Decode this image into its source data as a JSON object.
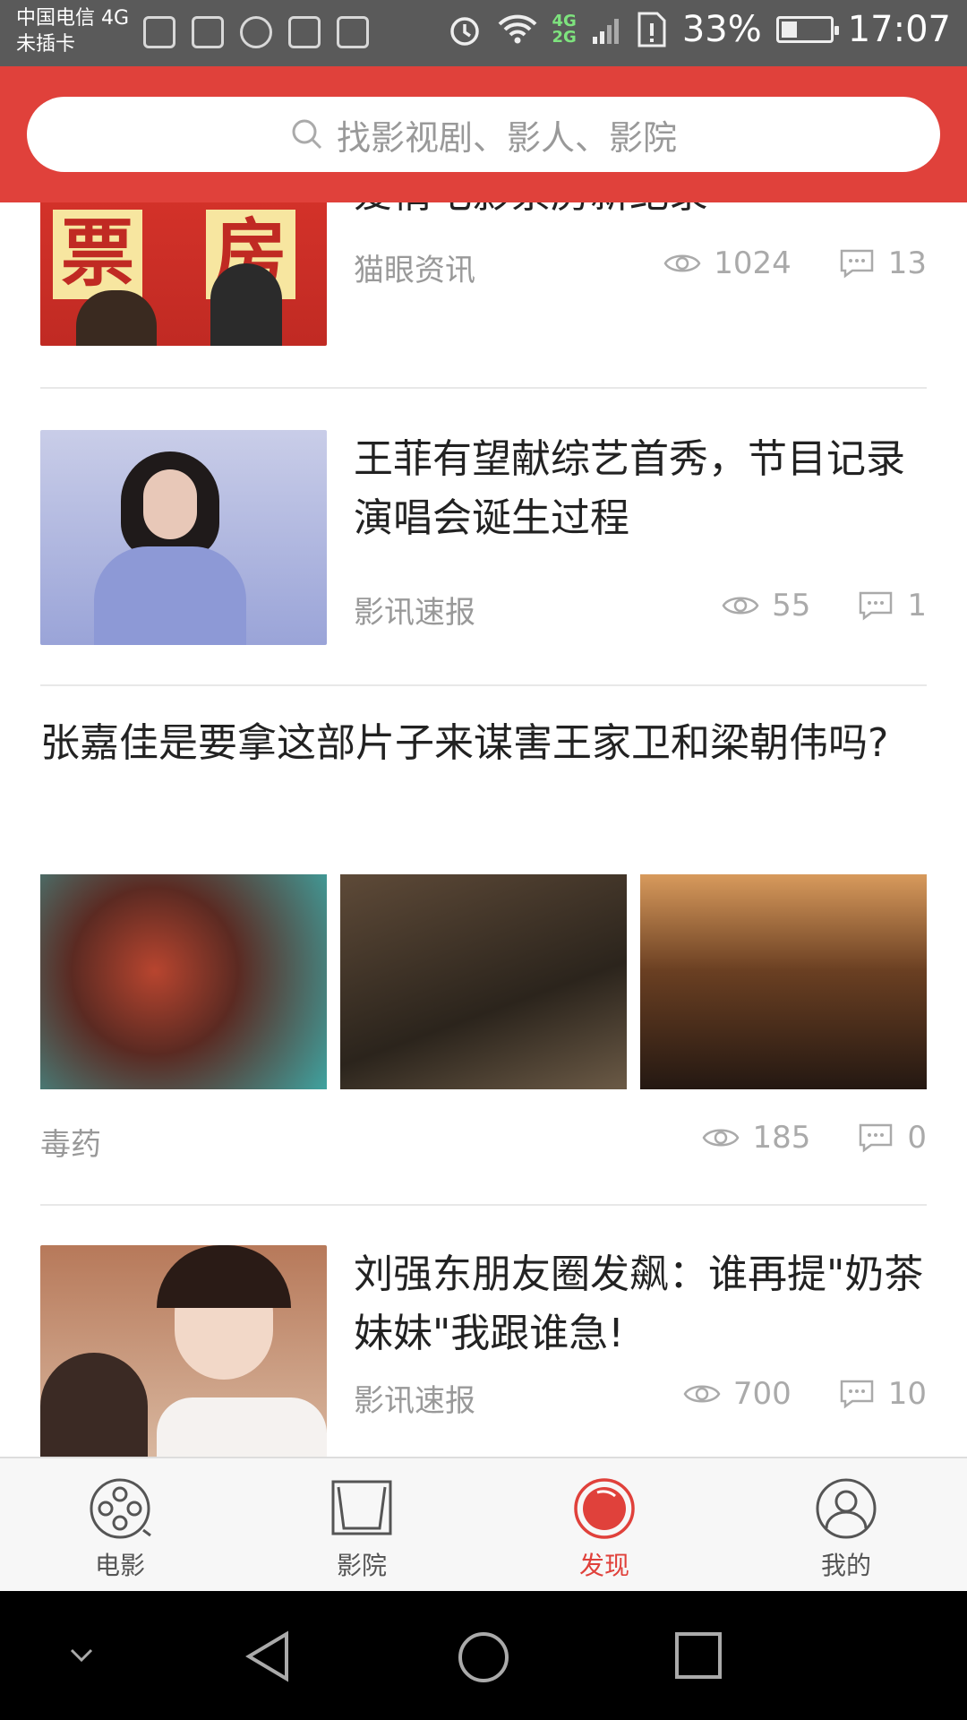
{
  "status_bar": {
    "carrier_line1": "中国电信 4G",
    "carrier_line2": "未插卡",
    "net_4g": "4G",
    "net_2g": "2G",
    "battery": "33%",
    "battery_level": 0.33,
    "time": "17:07"
  },
  "search": {
    "placeholder": "找影视剧、影人、影院"
  },
  "feed": [
    {
      "title": "爱情电影票房新纪录",
      "source": "猫眼资讯",
      "views": "1024",
      "comments": "13"
    },
    {
      "title": "王菲有望献综艺首秀，节目记录演唱会诞生过程",
      "source": "影讯速报",
      "views": "55",
      "comments": "1"
    },
    {
      "title": "张嘉佳是要拿这部片子来谋害王家卫和梁朝伟吗?",
      "source": "毒药",
      "views": "185",
      "comments": "0"
    },
    {
      "title": "刘强东朋友圈发飙：谁再提\"奶茶妹妹\"我跟谁急!",
      "source": "影讯速报",
      "views": "700",
      "comments": "10"
    }
  ],
  "thumb_text": {
    "char1": "票",
    "char2": "房"
  },
  "tabs": [
    {
      "label": "电影",
      "icon": "film-reel-icon"
    },
    {
      "label": "影院",
      "icon": "cinema-screen-icon"
    },
    {
      "label": "发现",
      "icon": "discover-icon"
    },
    {
      "label": "我的",
      "icon": "user-icon"
    }
  ],
  "colors": {
    "accent": "#e0413b",
    "muted": "#999999"
  }
}
